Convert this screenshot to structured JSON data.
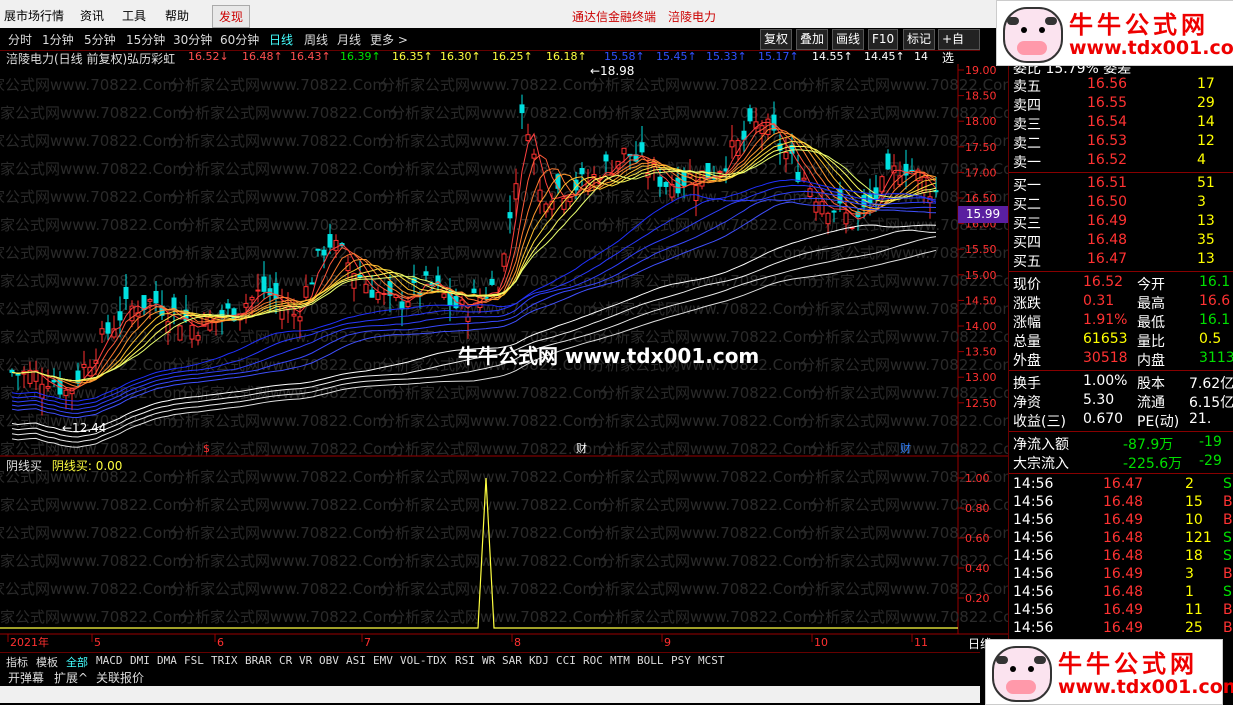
{
  "menubar": {
    "items": [
      "展市场行情",
      "资讯",
      "工具",
      "帮助",
      "发现"
    ],
    "banner_left": "通达信金融终端",
    "banner_right": "涪陵电力"
  },
  "toolbar": {
    "periods": [
      "分时",
      "1分钟",
      "5分钟",
      "15分钟",
      "30分钟",
      "60分钟",
      "日线",
      "周线",
      "月线",
      "更多 >"
    ],
    "active_period": "日线",
    "right_buttons": [
      "复权",
      "叠加",
      "画线",
      "F10",
      "标记",
      "+自选"
    ]
  },
  "chart": {
    "title": "涪陵电力(日线 前复权)弘历彩虹",
    "ma_values": [
      {
        "text": "16.52↓",
        "color": "#ff5050"
      },
      {
        "text": "16.48↑",
        "color": "#ff5050"
      },
      {
        "text": "16.43↑",
        "color": "#ff5050"
      },
      {
        "text": "16.39↑",
        "color": "#00e000"
      },
      {
        "text": "16.35↑",
        "color": "#ffff40"
      },
      {
        "text": "16.30↑",
        "color": "#ffff40"
      },
      {
        "text": "16.25↑",
        "color": "#ffff40"
      },
      {
        "text": "16.18↑",
        "color": "#ffff40"
      },
      {
        "text": "15.58↑",
        "color": "#3050ff"
      },
      {
        "text": "15.45↑",
        "color": "#3050ff"
      },
      {
        "text": "15.33↑",
        "color": "#3050ff"
      },
      {
        "text": "15.17↑",
        "color": "#3050ff"
      },
      {
        "text": "14.55↑",
        "color": "#ffffff"
      },
      {
        "text": "14.45↑",
        "color": "#ffffff"
      },
      {
        "text": "14",
        "color": "#ffffff"
      }
    ],
    "high_label": "18.98",
    "low_label": "12.44",
    "price_axis": [
      "19.00",
      "18.50",
      "18.00",
      "17.50",
      "17.00",
      "16.50",
      "16.00",
      "15.50",
      "15.00",
      "14.50",
      "14.00",
      "13.50",
      "13.00",
      "12.50"
    ],
    "current_price_tag": "15.99",
    "markers": [
      "$",
      "财",
      "财"
    ],
    "watermark_text": "分析家公式网www.70822.Com",
    "center_watermark": "牛牛公式网 www.tdx001.com",
    "time_axis": [
      "2021年",
      "5",
      "6",
      "7",
      "8",
      "9",
      "10",
      "11"
    ],
    "period_corner": "日线"
  },
  "indicator": {
    "name": "阴线买",
    "value_label": "阴线买: 0.00",
    "axis": [
      "1.00",
      "0.80",
      "0.60",
      "0.40",
      "0.20"
    ]
  },
  "tabs": {
    "items": [
      "指标",
      "模板",
      "全部",
      "MACD",
      "DMI",
      "DMA",
      "FSL",
      "TRIX",
      "BRAR",
      "CR",
      "VR",
      "OBV",
      "ASI",
      "EMV",
      "VOL-TDX",
      "RSI",
      "WR",
      "SAR",
      "KDJ",
      "CCI",
      "ROC",
      "MTM",
      "BOLL",
      "PSY",
      "MCST"
    ],
    "active": "全部"
  },
  "bottom_bar": [
    "开弹幕",
    "扩展^",
    "关联报价"
  ],
  "quote": {
    "header": "委比  15.79%  委差",
    "sells": [
      {
        "label": "卖五",
        "price": "16.56",
        "vol": "17"
      },
      {
        "label": "卖四",
        "price": "16.55",
        "vol": "29"
      },
      {
        "label": "卖三",
        "price": "16.54",
        "vol": "14"
      },
      {
        "label": "卖二",
        "price": "16.53",
        "vol": "12"
      },
      {
        "label": "卖一",
        "price": "16.52",
        "vol": "4"
      }
    ],
    "buys": [
      {
        "label": "买一",
        "price": "16.51",
        "vol": "51"
      },
      {
        "label": "买二",
        "price": "16.50",
        "vol": "3"
      },
      {
        "label": "买三",
        "price": "16.49",
        "vol": "13"
      },
      {
        "label": "买四",
        "price": "16.48",
        "vol": "35"
      },
      {
        "label": "买五",
        "price": "16.47",
        "vol": "13"
      }
    ],
    "stats1": [
      {
        "l1": "现价",
        "v1": "16.52",
        "c1": "red",
        "l2": "今开",
        "v2": "16.1",
        "c2": "green"
      },
      {
        "l1": "涨跌",
        "v1": "0.31",
        "c1": "red",
        "l2": "最高",
        "v2": "16.6",
        "c2": "red"
      },
      {
        "l1": "涨幅",
        "v1": "1.91%",
        "c1": "red",
        "l2": "最低",
        "v2": "16.1",
        "c2": "green"
      },
      {
        "l1": "总量",
        "v1": "61653",
        "c1": "yellow",
        "l2": "量比",
        "v2": "0.5",
        "c2": "yellow"
      },
      {
        "l1": "外盘",
        "v1": "30518",
        "c1": "red",
        "l2": "内盘",
        "v2": "3113",
        "c2": "green"
      }
    ],
    "stats2": [
      {
        "l1": "换手",
        "v1": "1.00%",
        "l2": "股本",
        "v2": "7.62亿"
      },
      {
        "l1": "净资",
        "v1": "5.30",
        "l2": "流通",
        "v2": "6.15亿"
      },
      {
        "l1": "收益(三)",
        "v1": "0.670",
        "l2": "PE(动)",
        "v2": "21."
      }
    ],
    "flows": [
      {
        "label": "净流入额",
        "value": "-87.9万",
        "pct": "-19"
      },
      {
        "label": "大宗流入",
        "value": "-225.6万",
        "pct": "-29"
      }
    ],
    "ticks": [
      {
        "time": "14:56",
        "price": "16.47",
        "vol": "2",
        "flag": "S"
      },
      {
        "time": "14:56",
        "price": "16.48",
        "vol": "15",
        "flag": "B"
      },
      {
        "time": "14:56",
        "price": "16.49",
        "vol": "10",
        "flag": "B"
      },
      {
        "time": "14:56",
        "price": "16.48",
        "vol": "121",
        "flag": "S"
      },
      {
        "time": "14:56",
        "price": "16.48",
        "vol": "18",
        "flag": "S"
      },
      {
        "time": "14:56",
        "price": "16.49",
        "vol": "3",
        "flag": "B"
      },
      {
        "time": "14:56",
        "price": "16.48",
        "vol": "1",
        "flag": "S"
      },
      {
        "time": "14:56",
        "price": "16.49",
        "vol": "11",
        "flag": "B"
      },
      {
        "time": "14:56",
        "price": "16.49",
        "vol": "25",
        "flag": "B"
      }
    ]
  },
  "watermark": {
    "title": "牛牛公式网",
    "url": "www.tdx001.com"
  }
}
